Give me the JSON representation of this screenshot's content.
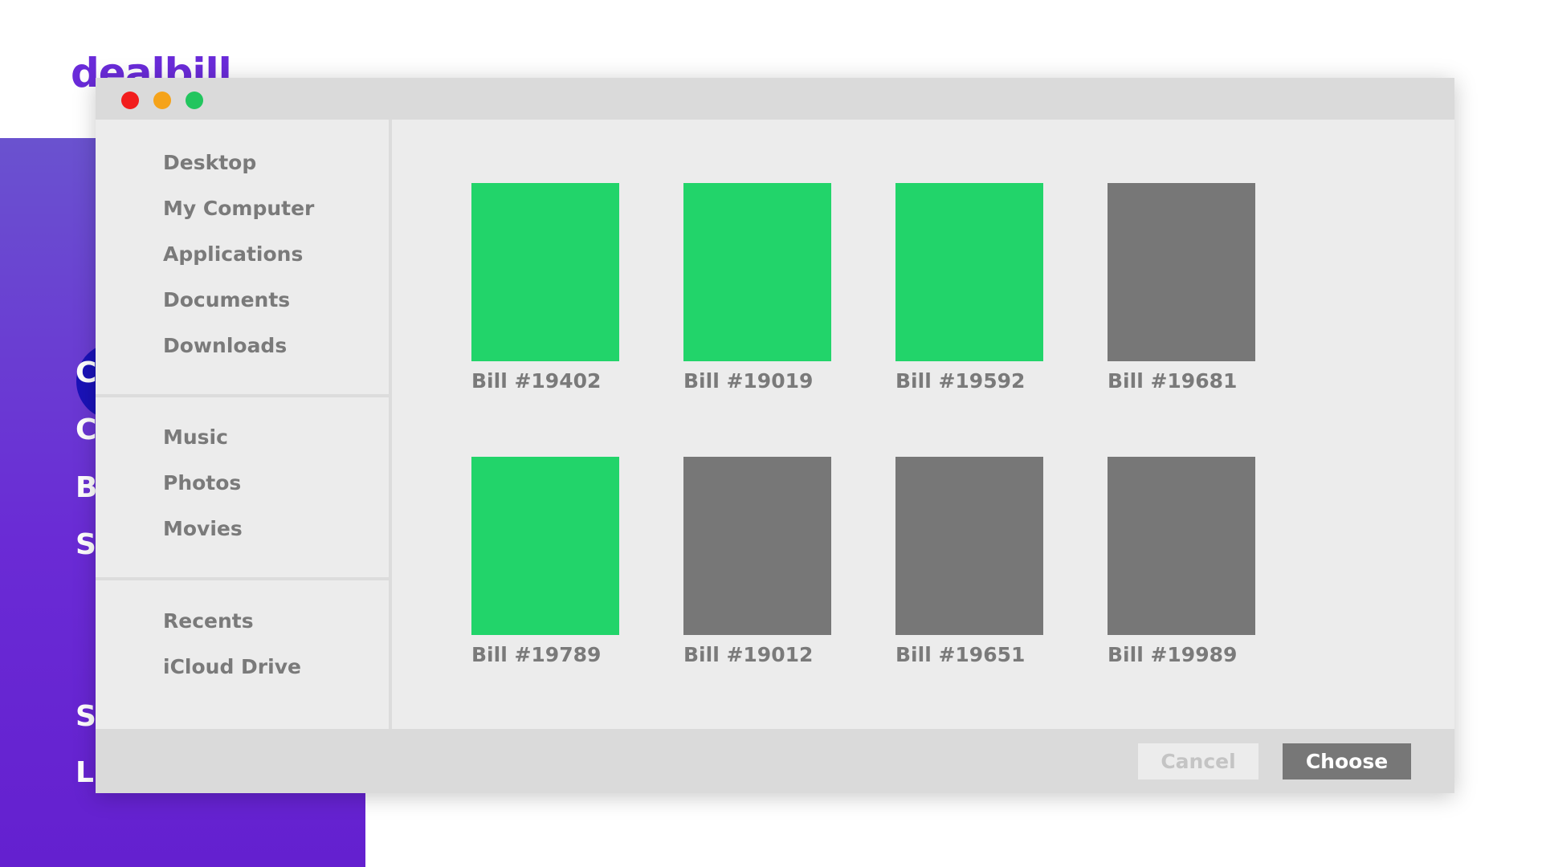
{
  "app": {
    "logo": "dealbill",
    "background_letters": [
      "C",
      "C",
      "B",
      "S",
      "S",
      "L"
    ]
  },
  "window": {
    "controls": [
      "close",
      "minimize",
      "maximize"
    ]
  },
  "sidebar": {
    "groups": [
      {
        "items": [
          {
            "label": "Desktop"
          },
          {
            "label": "My Computer"
          },
          {
            "label": "Applications"
          },
          {
            "label": "Documents"
          },
          {
            "label": "Downloads"
          }
        ]
      },
      {
        "items": [
          {
            "label": "Music"
          },
          {
            "label": "Photos"
          },
          {
            "label": "Movies"
          }
        ]
      },
      {
        "items": [
          {
            "label": "Recents"
          },
          {
            "label": "iCloud Drive"
          }
        ]
      }
    ]
  },
  "files": [
    {
      "label": "Bill #19402",
      "color": "#22d46a"
    },
    {
      "label": "Bill #19019",
      "color": "#22d46a"
    },
    {
      "label": "Bill #19592",
      "color": "#22d46a"
    },
    {
      "label": "Bill #19681",
      "color": "#777777"
    },
    {
      "label": "Bill #19789",
      "color": "#22d46a"
    },
    {
      "label": "Bill #19012",
      "color": "#777777"
    },
    {
      "label": "Bill #19651",
      "color": "#777777"
    },
    {
      "label": "Bill #19989",
      "color": "#777777"
    }
  ],
  "footer": {
    "cancel_label": "Cancel",
    "choose_label": "Choose"
  },
  "colors": {
    "brand": "#6a2bd9",
    "paid": "#22d46a",
    "unpaid": "#777777"
  }
}
